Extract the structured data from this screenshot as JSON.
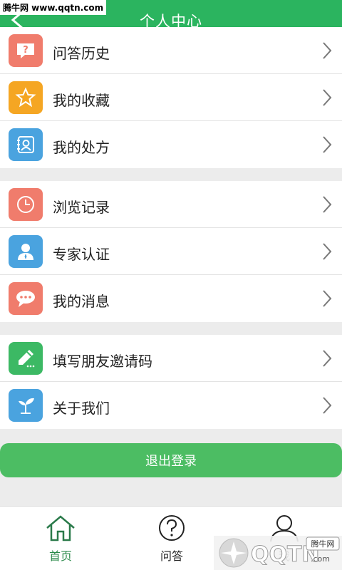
{
  "watermark_top": "腾牛网 www.qqtn.com",
  "header": {
    "title": "个人中心"
  },
  "groups": [
    {
      "items": [
        {
          "label": "问答历史",
          "icon": "question-bubble-icon",
          "color": "#f07c6c"
        },
        {
          "label": "我的收藏",
          "icon": "star-icon",
          "color": "#f5a623"
        },
        {
          "label": "我的处方",
          "icon": "prescription-icon",
          "color": "#4aa3df"
        }
      ]
    },
    {
      "items": [
        {
          "label": "浏览记录",
          "icon": "clock-icon",
          "color": "#f07c6c"
        },
        {
          "label": "专家认证",
          "icon": "user-icon",
          "color": "#4aa3df"
        },
        {
          "label": "我的消息",
          "icon": "chat-icon",
          "color": "#f07c6c"
        }
      ]
    },
    {
      "items": [
        {
          "label": "填写朋友邀请码",
          "icon": "pencil-icon",
          "color": "#3cb964"
        },
        {
          "label": "关于我们",
          "icon": "sprout-icon",
          "color": "#4aa3df"
        }
      ]
    }
  ],
  "logout_label": "退出登录",
  "tabbar": {
    "home": "首页",
    "qa": "问答",
    "me": "我"
  },
  "watermark_bottom": {
    "brand": "QQTN.com",
    "site": "腾牛网"
  },
  "colors": {
    "primary": "#2bb45f",
    "button": "#4cbd63",
    "background": "#ececec"
  }
}
